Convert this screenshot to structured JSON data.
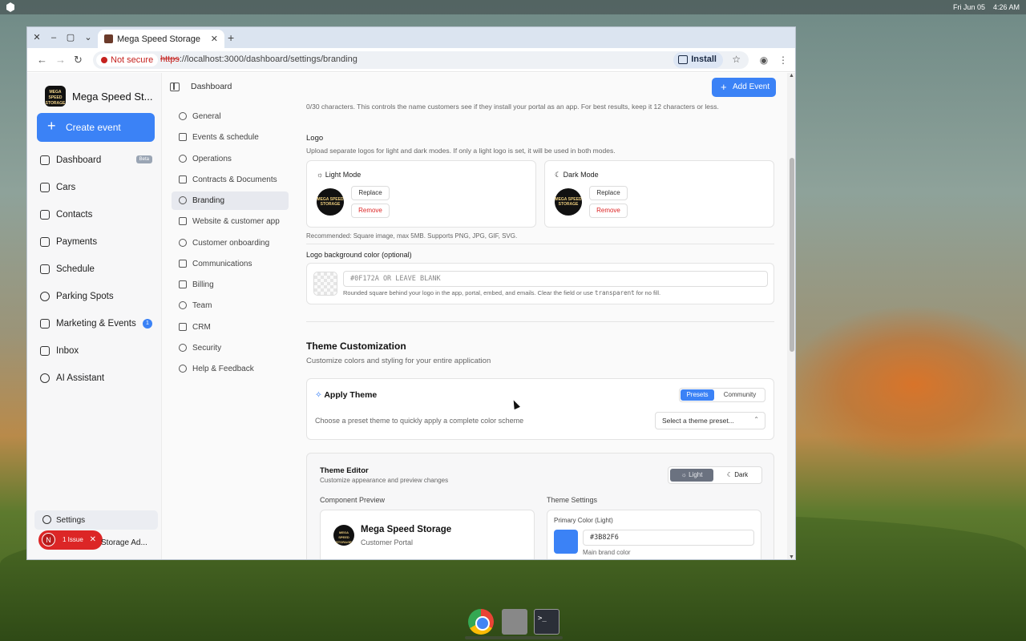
{
  "desktop": {
    "date": "Fri Jun 05",
    "time": "4:26 AM"
  },
  "browser": {
    "tab_title": "Mega Speed Storage",
    "not_secure": "Not secure",
    "url_scheme": "https",
    "url_rest": "://localhost:3000/dashboard/settings/branding",
    "install_label": "Install"
  },
  "sidebar": {
    "brand_name": "Mega Speed St...",
    "brand_logo_text": "MEGA SPEED STORAGE",
    "create_label": "Create event",
    "items": [
      {
        "label": "Dashboard",
        "badge": "Beta",
        "icon": "grid-icon"
      },
      {
        "label": "Cars",
        "icon": "car-icon"
      },
      {
        "label": "Contacts",
        "icon": "users-icon"
      },
      {
        "label": "Payments",
        "icon": "credit-card-icon"
      },
      {
        "label": "Schedule",
        "icon": "calendar-icon"
      },
      {
        "label": "Parking Spots",
        "icon": "map-pin-icon"
      },
      {
        "label": "Marketing & Events",
        "badge": "1",
        "icon": "megaphone-icon"
      },
      {
        "label": "Inbox",
        "icon": "message-icon"
      },
      {
        "label": "AI Assistant",
        "icon": "ai-icon"
      }
    ],
    "settings_label": "Settings",
    "issue_label": "1 Issue",
    "issue_avatar": "N",
    "storage_ad": "Storage Ad..."
  },
  "header": {
    "breadcrumb": "Dashboard",
    "add_event": "Add Event"
  },
  "subnav": [
    {
      "label": "General"
    },
    {
      "label": "Events & schedule"
    },
    {
      "label": "Operations"
    },
    {
      "label": "Contracts & Documents"
    },
    {
      "label": "Branding",
      "active": true
    },
    {
      "label": "Website & customer app"
    },
    {
      "label": "Customer onboarding"
    },
    {
      "label": "Communications"
    },
    {
      "label": "Billing"
    },
    {
      "label": "Team"
    },
    {
      "label": "CRM"
    },
    {
      "label": "Security"
    },
    {
      "label": "Help & Feedback"
    }
  ],
  "content": {
    "char_hint": "0/30 characters. This controls the name customers see if they install your portal as an app. For best results, keep it 12 characters or less.",
    "logo_title": "Logo",
    "logo_desc": "Upload separate logos for light and dark modes. If only a light logo is set, it will be used in both modes.",
    "light_mode": "Light Mode",
    "dark_mode": "Dark Mode",
    "replace": "Replace",
    "remove": "Remove",
    "recommended": "Recommended: Square image, max 5MB. Supports PNG, JPG, GIF, SVG.",
    "logo_bg_title": "Logo background color (optional)",
    "logo_bg_placeholder": "#0F172A OR LEAVE BLANK",
    "logo_bg_help_1": "Rounded square behind your logo in the app, portal, embed, and emails. Clear the field or use ",
    "logo_bg_help_code": "transparent",
    "logo_bg_help_2": " for no fill.",
    "theme_title": "Theme Customization",
    "theme_desc": "Customize colors and styling for your entire application",
    "apply_theme": "Apply Theme",
    "presets": "Presets",
    "community": "Community",
    "apply_desc": "Choose a preset theme to quickly apply a complete color scheme",
    "select_preset": "Select a theme preset...",
    "editor_title": "Theme Editor",
    "editor_desc": "Customize appearance and preview changes",
    "light": "Light",
    "dark": "Dark",
    "component_preview": "Component Preview",
    "preview_name": "Mega Speed Storage",
    "preview_sub": "Customer Portal",
    "theme_settings": "Theme Settings",
    "primary_color_label": "Primary Color (Light)",
    "primary_color_value": "#3B82F6",
    "primary_color_help": "Main brand color"
  },
  "colors": {
    "primary": "#3B82F6",
    "danger": "#DC2626"
  }
}
